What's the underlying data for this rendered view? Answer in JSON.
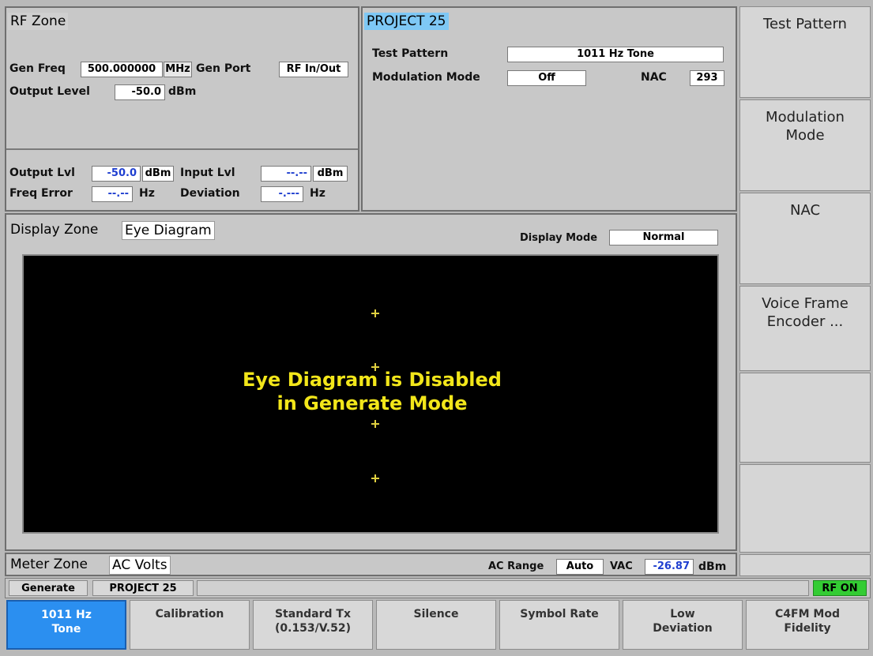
{
  "rf_zone": {
    "title": "RF Zone",
    "gen_freq_label": "Gen Freq",
    "gen_freq_value": "500.000000",
    "gen_freq_unit": "MHz",
    "gen_port_label": "Gen Port",
    "gen_port_value": "RF In/Out",
    "output_level_label": "Output Level",
    "output_level_value": "-50.0",
    "output_level_unit": "dBm",
    "output_lvl_label": "Output Lvl",
    "output_lvl_value": "-50.0",
    "output_lvl_unit": "dBm",
    "input_lvl_label": "Input Lvl",
    "input_lvl_value": "--.--",
    "input_lvl_unit": "dBm",
    "freq_error_label": "Freq Error",
    "freq_error_value": "--.--",
    "freq_error_unit": "Hz",
    "deviation_label": "Deviation",
    "deviation_value": "-.---",
    "deviation_unit": "Hz"
  },
  "project_zone": {
    "title": "PROJECT 25",
    "test_pattern_label": "Test Pattern",
    "test_pattern_value": "1011 Hz Tone",
    "modulation_mode_label": "Modulation Mode",
    "modulation_mode_value": "Off",
    "nac_label": "NAC",
    "nac_value": "293"
  },
  "display_zone": {
    "title": "Display Zone",
    "selected": "Eye Diagram",
    "display_mode_label": "Display Mode",
    "display_mode_value": "Normal",
    "message_line1": "Eye Diagram is Disabled",
    "message_line2": "in Generate Mode"
  },
  "meter_zone": {
    "title": "Meter Zone",
    "selected": "AC Volts",
    "ac_range_label": "AC Range",
    "ac_range_value": "Auto",
    "vac_label": "VAC",
    "vac_value": "-26.87",
    "vac_unit": "dBm"
  },
  "status_bar": {
    "mode": "Generate",
    "system": "PROJECT 25",
    "rf_status": "RF ON"
  },
  "softkeys": [
    {
      "label": "Test Pattern"
    },
    {
      "label": "Modulation\nMode"
    },
    {
      "label": "NAC"
    },
    {
      "label": "Voice Frame\nEncoder ..."
    },
    {
      "label": ""
    },
    {
      "label": ""
    }
  ],
  "bottom_buttons": [
    {
      "label": "1011 Hz\nTone"
    },
    {
      "label": "Calibration"
    },
    {
      "label": "Standard Tx\n(0.153/V.52)"
    },
    {
      "label": "Silence"
    },
    {
      "label": "Symbol Rate"
    },
    {
      "label": "Low\nDeviation"
    },
    {
      "label": "C4FM Mod\nFidelity"
    }
  ],
  "colors": {
    "accent_blue": "#2b8ff0",
    "value_blue": "#1f3fd0",
    "message_yellow": "#f2e61a",
    "rf_on_green": "#33cc33",
    "title_highlight": "#7ec8f5"
  }
}
